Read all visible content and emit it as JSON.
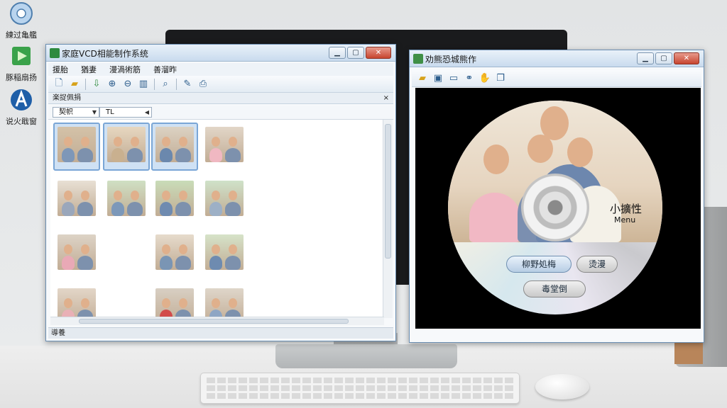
{
  "desktop": {
    "icons": [
      {
        "label": "練过亀艦",
        "icon": "cd-disc-icon"
      },
      {
        "label": "豚稲扇扬",
        "icon": "green-play-icon"
      },
      {
        "label": "说火戢窗",
        "icon": "blue-a-app-icon"
      }
    ]
  },
  "main_window": {
    "title": "家庭VCD相能制作系统",
    "menu": [
      "援胎",
      "猶妻",
      "漫渦術筋",
      "善溜昨"
    ],
    "toolbar_icons": [
      "new-file-icon",
      "open-folder-icon",
      "import-icon",
      "zoom-in-icon",
      "zoom-out-icon",
      "columns-icon",
      "search-icon",
      "edit-icon",
      "print-icon"
    ],
    "panel_title": "楽捉佩捐",
    "panel_close": "×",
    "filter": {
      "left_value": "契帜",
      "right_value": "TL"
    },
    "status": "導養",
    "photo_count": 15
  },
  "preview_window": {
    "title": "劝熊恐城熊作",
    "toolbar_icons": [
      "open-icon",
      "save-icon",
      "monitor-icon",
      "link-icon",
      "hand-icon",
      "copy-icon"
    ],
    "disc": {
      "title": "小擴性",
      "subtitle": "Menu"
    },
    "buttons": [
      {
        "label": "柳野処梅",
        "style": "blue"
      },
      {
        "label": "烫漫",
        "style": "blue"
      },
      {
        "label": "毒堂倒",
        "style": "gray"
      }
    ]
  },
  "window_controls": {
    "minimize": "▁",
    "maximize": "▢",
    "close": "✕"
  }
}
